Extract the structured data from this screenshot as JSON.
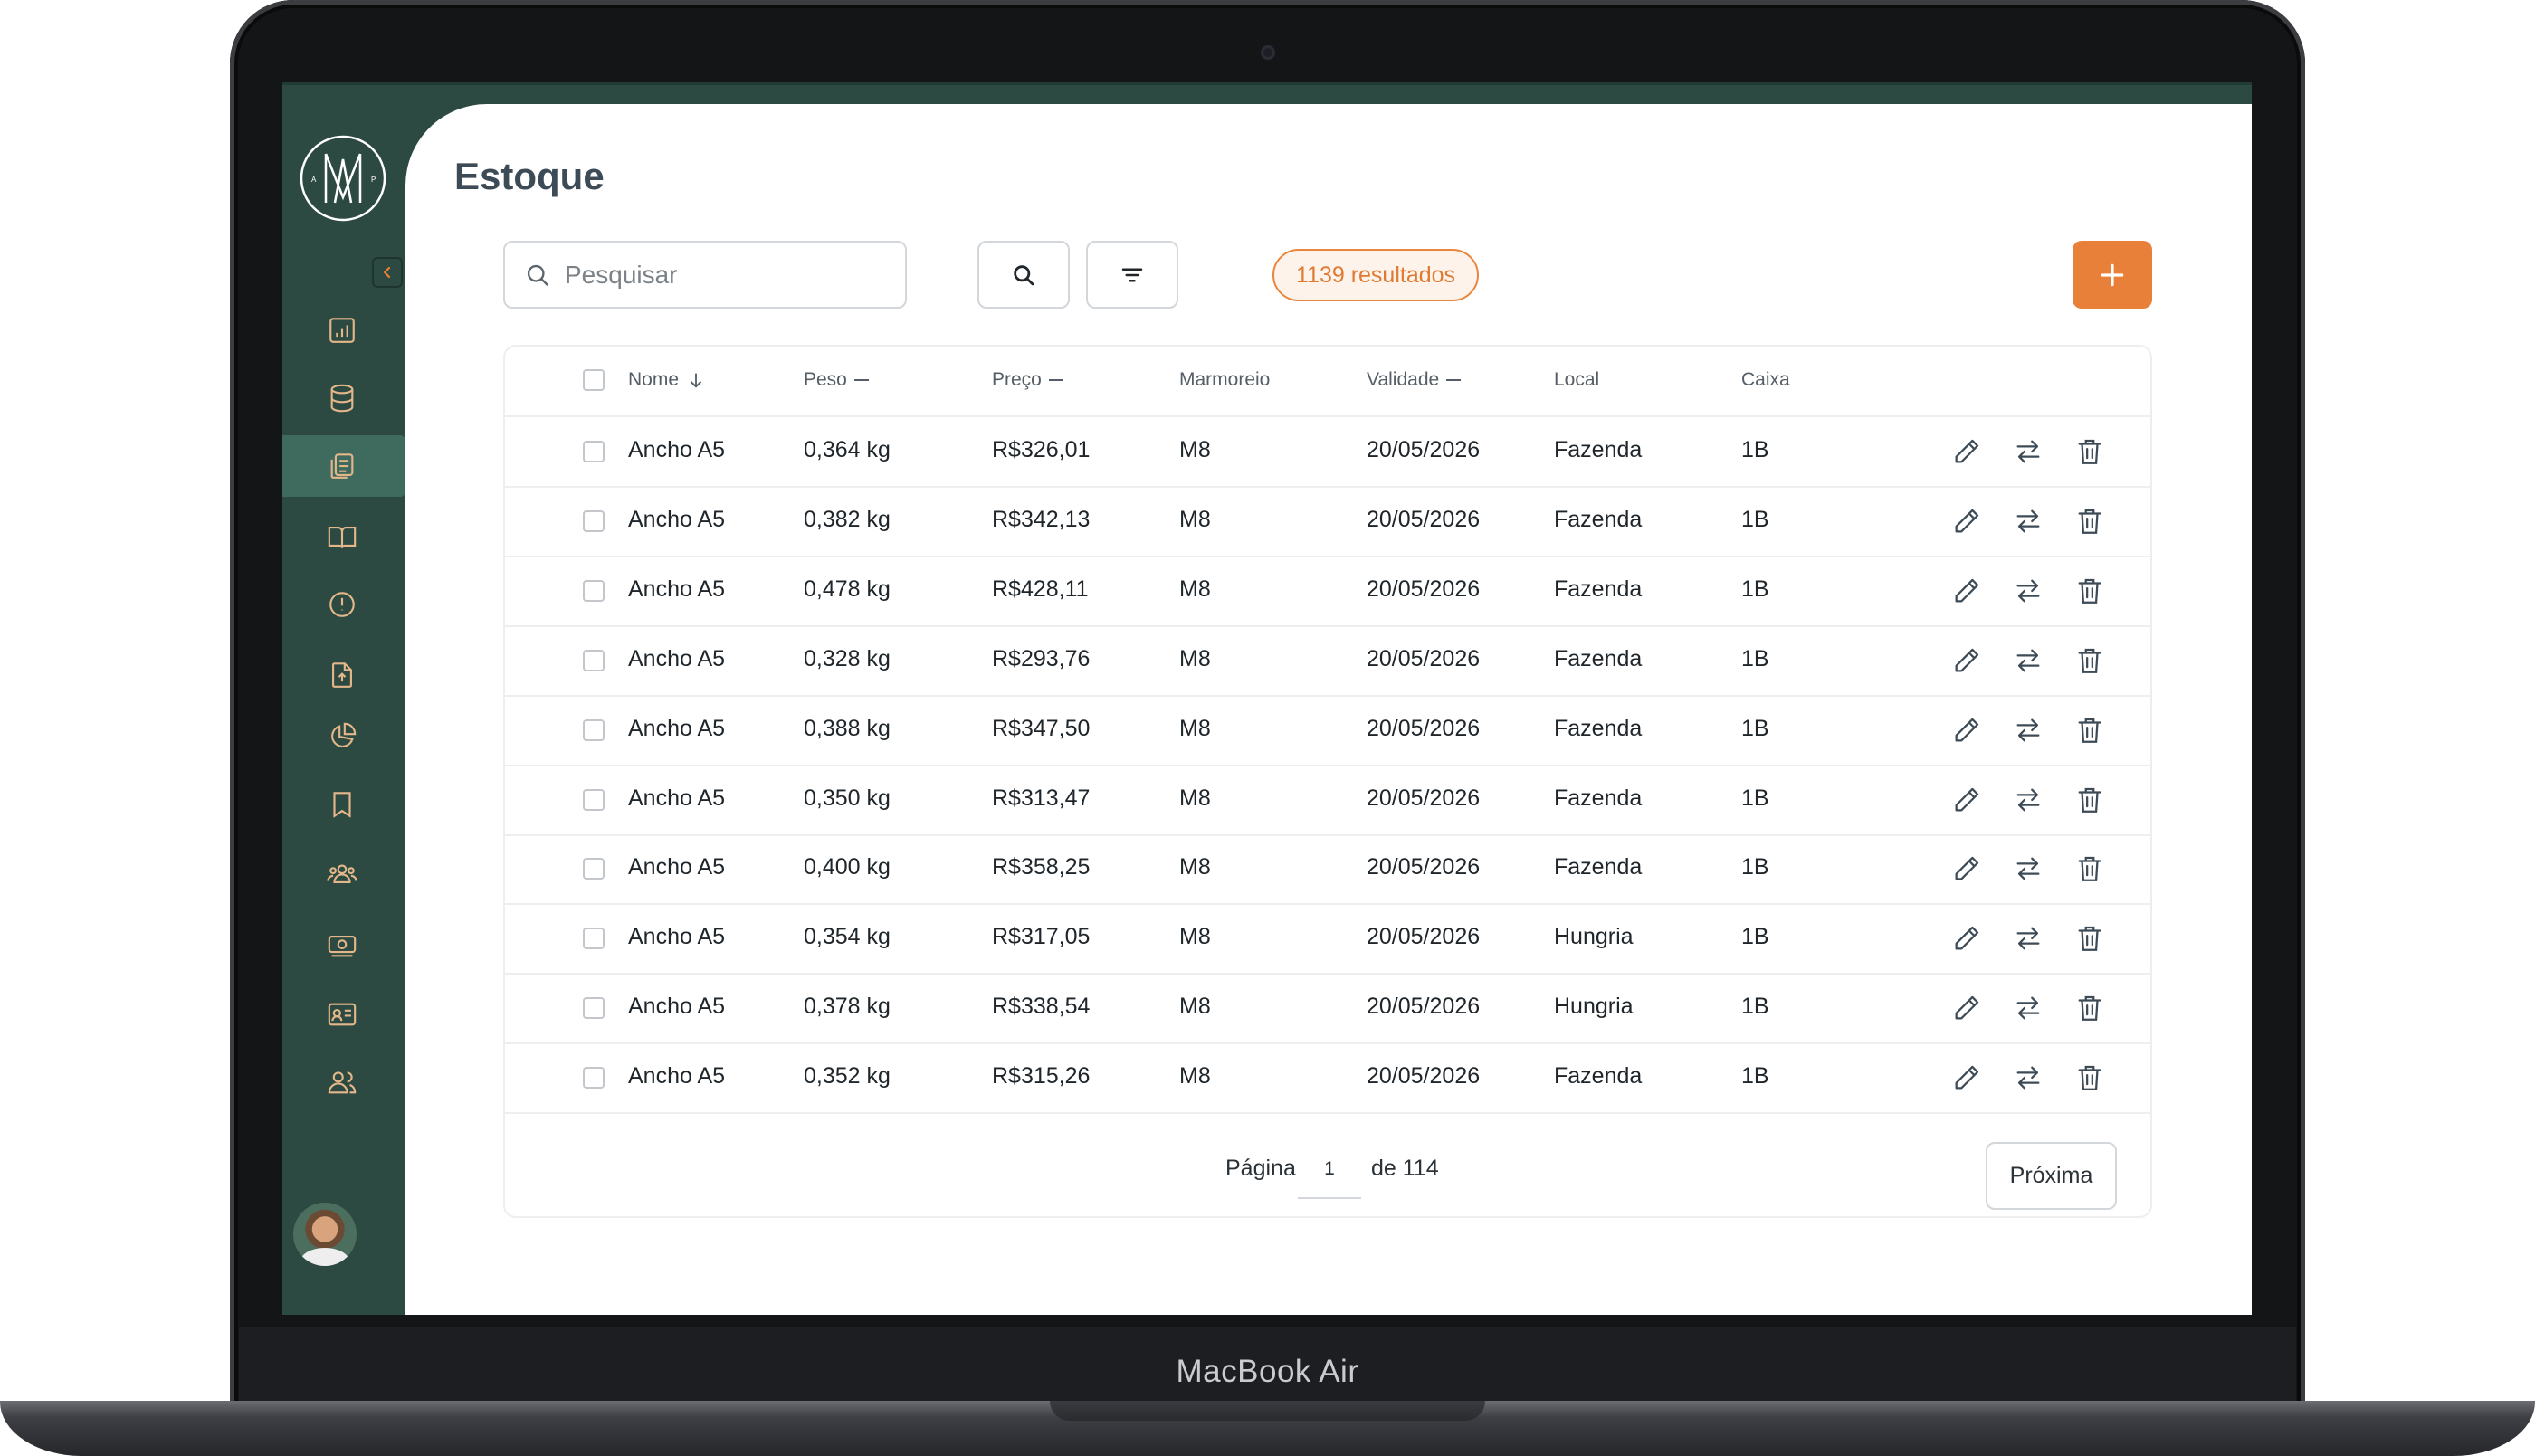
{
  "device": {
    "brand": "MacBook Air"
  },
  "page": {
    "title": "Estoque"
  },
  "toolbar": {
    "search_placeholder": "Pesquisar",
    "search_value": "",
    "results_label": "1139 resultados"
  },
  "sidebar": {
    "items": [
      {
        "icon": "bar-chart-icon"
      },
      {
        "icon": "database-icon"
      },
      {
        "icon": "clipboard-list-icon",
        "active": true
      },
      {
        "icon": "book-open-icon"
      },
      {
        "icon": "alert-circle-icon"
      },
      {
        "icon": "file-upload-icon"
      },
      {
        "icon": "pie-chart-icon"
      },
      {
        "icon": "bookmark-icon"
      },
      {
        "icon": "users-group-icon"
      },
      {
        "icon": "money-icon"
      },
      {
        "icon": "id-card-icon"
      },
      {
        "icon": "users-icon"
      }
    ]
  },
  "table": {
    "headers": {
      "nome": "Nome",
      "peso": "Peso",
      "preco": "Preço",
      "marmoreio": "Marmoreio",
      "validade": "Validade",
      "local": "Local",
      "caixa": "Caixa"
    },
    "rows": [
      {
        "nome": "Ancho A5",
        "peso": "0,364 kg",
        "preco": "R$326,01",
        "marmoreio": "M8",
        "validade": "20/05/2026",
        "local": "Fazenda",
        "caixa": "1B"
      },
      {
        "nome": "Ancho A5",
        "peso": "0,382 kg",
        "preco": "R$342,13",
        "marmoreio": "M8",
        "validade": "20/05/2026",
        "local": "Fazenda",
        "caixa": "1B"
      },
      {
        "nome": "Ancho A5",
        "peso": "0,478 kg",
        "preco": "R$428,11",
        "marmoreio": "M8",
        "validade": "20/05/2026",
        "local": "Fazenda",
        "caixa": "1B"
      },
      {
        "nome": "Ancho A5",
        "peso": "0,328 kg",
        "preco": "R$293,76",
        "marmoreio": "M8",
        "validade": "20/05/2026",
        "local": "Fazenda",
        "caixa": "1B"
      },
      {
        "nome": "Ancho A5",
        "peso": "0,388 kg",
        "preco": "R$347,50",
        "marmoreio": "M8",
        "validade": "20/05/2026",
        "local": "Fazenda",
        "caixa": "1B"
      },
      {
        "nome": "Ancho A5",
        "peso": "0,350 kg",
        "preco": "R$313,47",
        "marmoreio": "M8",
        "validade": "20/05/2026",
        "local": "Fazenda",
        "caixa": "1B"
      },
      {
        "nome": "Ancho A5",
        "peso": "0,400 kg",
        "preco": "R$358,25",
        "marmoreio": "M8",
        "validade": "20/05/2026",
        "local": "Fazenda",
        "caixa": "1B"
      },
      {
        "nome": "Ancho A5",
        "peso": "0,354 kg",
        "preco": "R$317,05",
        "marmoreio": "M8",
        "validade": "20/05/2026",
        "local": "Hungria",
        "caixa": "1B"
      },
      {
        "nome": "Ancho A5",
        "peso": "0,378 kg",
        "preco": "R$338,54",
        "marmoreio": "M8",
        "validade": "20/05/2026",
        "local": "Hungria",
        "caixa": "1B"
      },
      {
        "nome": "Ancho A5",
        "peso": "0,352 kg",
        "preco": "R$315,26",
        "marmoreio": "M8",
        "validade": "20/05/2026",
        "local": "Fazenda",
        "caixa": "1B"
      }
    ]
  },
  "pagination": {
    "page_label": "Página",
    "current_page": "1",
    "total_label": "de 114",
    "next_label": "Próxima"
  },
  "colors": {
    "sidebar": "#2d4a42",
    "sidebar_active": "#3f6b5e",
    "sidebar_icon": "#e3b789",
    "accent": "#e8803a"
  }
}
